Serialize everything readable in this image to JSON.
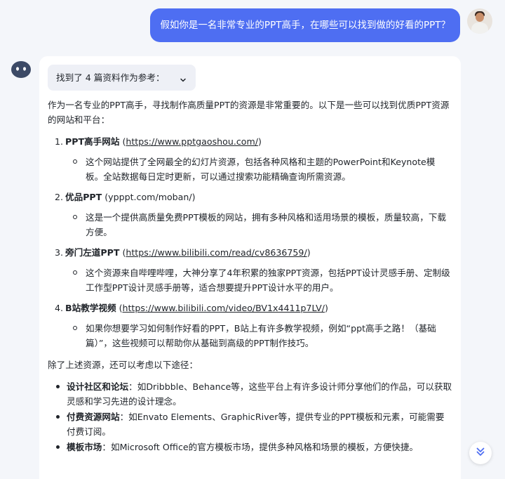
{
  "question": "假如你是一名非常专业的PPT高手，在哪些可以找到做的好看的PPT？",
  "answer": {
    "refs_label": "找到了 4 篇资料作为参考：",
    "intro": "作为一名专业的PPT高手，寻找制作高质量PPT的资源是非常重要的。以下是一些可以找到优质PPT资源的网站和平台：",
    "sites": [
      {
        "num": "1.",
        "name": "PPT高手网站",
        "open": " (",
        "link": "https://www.pptgaoshou.com/",
        "close": ")",
        "desc": "这个网站提供了全网最全的幻灯片资源，包括各种风格和主题的PowerPoint和Keynote模板。全站数据每日定时更新，可以通过搜索功能精确查询所需资源。"
      },
      {
        "num": "2.",
        "name": "优品PPT",
        "open": " (",
        "link": "ypppt.com/moban/",
        "close": ")",
        "desc": "这是一个提供高质量免费PPT模板的网站，拥有多种风格和适用场景的模板，质量较高，下载方便。"
      },
      {
        "num": "3.",
        "name": "旁门左道PPT",
        "open": " (",
        "link": "https://www.bilibili.com/read/cv8636759/",
        "close": ")",
        "desc": "这个资源来自哔哩哔哩，大神分享了4年积累的独家PPT资源，包括PPT设计灵感手册、定制级工作型PPT设计灵感手册等，适合想要提升PPT设计水平的用户。"
      },
      {
        "num": "4.",
        "name": "B站教学视频",
        "open": " (",
        "link": "https://www.bilibili.com/video/BV1x4411p7LV/",
        "close": ")",
        "desc": "如果你想要学习如何制作好看的PPT，B站上有许多教学视频，例如“ppt高手之路！（基础篇）”，这些视频可以帮助你从基础到高级的PPT制作技巧。"
      }
    ],
    "other_intro": "除了上述资源，还可以考虑以下途径：",
    "routes": [
      {
        "title": "设计社区和论坛",
        "text": "：如Dribbble、Behance等，这些平台上有许多设计师分享他们的作品，可以获取灵感和学习先进的设计理念。"
      },
      {
        "title": "付费资源网站",
        "text": "：如Envato Elements、GraphicRiver等，提供专业的PPT模板和元素，可能需要付费订阅。"
      },
      {
        "title": "模板市场",
        "text": "：如Microsoft Office的官方模板市场，提供多种风格和场景的模板，方便快捷。"
      }
    ]
  },
  "icons": {
    "bot": "robot-icon",
    "chevron": "chevron-down-icon",
    "scroll": "double-chevron-down-icon"
  },
  "colors": {
    "user_bubble": "#4e6ef2",
    "scroll_icon": "#4e6ef2",
    "bot_icon": "#3c4a66"
  }
}
